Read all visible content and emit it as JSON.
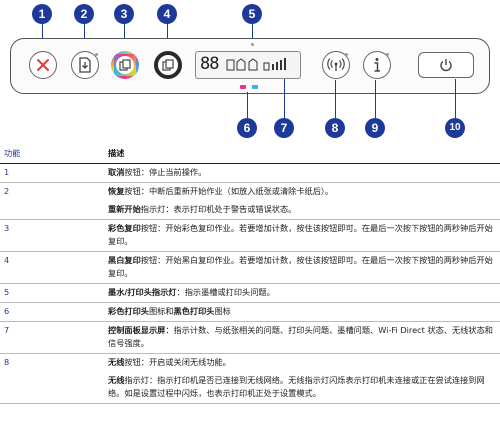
{
  "callouts": [
    "1",
    "2",
    "3",
    "4",
    "5",
    "6",
    "7",
    "8",
    "9",
    "10"
  ],
  "display": {
    "segments": "88"
  },
  "table": {
    "headers": {
      "feature": "功能",
      "description": "描述"
    },
    "rows": [
      {
        "num": "1",
        "paras": [
          {
            "bold": "取消",
            "text": "按钮：停止当前操作。"
          }
        ]
      },
      {
        "num": "2",
        "paras": [
          {
            "bold": "恢复",
            "text": "按钮：中断后重新开始作业（如放入纸张或清除卡纸后）。"
          },
          {
            "bold": "重新开始",
            "text": "指示灯：表示打印机处于警告或错误状态。"
          }
        ]
      },
      {
        "num": "3",
        "paras": [
          {
            "bold": "彩色复印",
            "text": "按钮：开始彩色复印作业。若要增加计数，按住该按钮即可。在最后一次按下按钮的两秒钟后开始复印。"
          }
        ]
      },
      {
        "num": "4",
        "paras": [
          {
            "bold": "黑白复印",
            "text": "按钮：开始黑白复印作业。若要增加计数，按住该按钮即可。在最后一次按下按钮的两秒钟后开始复印。"
          }
        ]
      },
      {
        "num": "5",
        "paras": [
          {
            "bold": "墨水/打印头指示灯",
            "text": "：指示墨槽或打印头问题。"
          }
        ]
      },
      {
        "num": "6",
        "paras": [
          {
            "bold": "彩色打印头",
            "text": "图标和",
            "bold2": "黑色打印头",
            "text2": "图标"
          }
        ]
      },
      {
        "num": "7",
        "paras": [
          {
            "bold": "控制面板显示屏",
            "text": "：指示计数、与纸张相关的问题、打印头问题、墨槽问题、Wi-Fi Direct 状态、无线状态和信号强度。"
          }
        ]
      },
      {
        "num": "8",
        "paras": [
          {
            "bold": "无线",
            "text": "按钮：开启或关闭无线功能。"
          },
          {
            "bold": "无线",
            "text": "指示灯：指示打印机是否已连接到无线网络。无线指示灯闪烁表示打印机未连接或正在尝试连接到网络。如是设置过程中闪烁，也表示打印机正处于设置模式。"
          }
        ]
      }
    ]
  }
}
